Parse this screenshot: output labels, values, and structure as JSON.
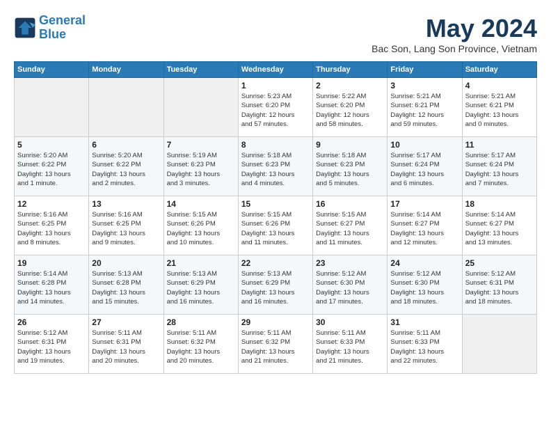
{
  "header": {
    "logo_line1": "General",
    "logo_line2": "Blue",
    "title": "May 2024",
    "subtitle": "Bac Son, Lang Son Province, Vietnam"
  },
  "days_of_week": [
    "Sunday",
    "Monday",
    "Tuesday",
    "Wednesday",
    "Thursday",
    "Friday",
    "Saturday"
  ],
  "weeks": [
    [
      {
        "day": "",
        "info": ""
      },
      {
        "day": "",
        "info": ""
      },
      {
        "day": "",
        "info": ""
      },
      {
        "day": "1",
        "info": "Sunrise: 5:23 AM\nSunset: 6:20 PM\nDaylight: 12 hours\nand 57 minutes."
      },
      {
        "day": "2",
        "info": "Sunrise: 5:22 AM\nSunset: 6:20 PM\nDaylight: 12 hours\nand 58 minutes."
      },
      {
        "day": "3",
        "info": "Sunrise: 5:21 AM\nSunset: 6:21 PM\nDaylight: 12 hours\nand 59 minutes."
      },
      {
        "day": "4",
        "info": "Sunrise: 5:21 AM\nSunset: 6:21 PM\nDaylight: 13 hours\nand 0 minutes."
      }
    ],
    [
      {
        "day": "5",
        "info": "Sunrise: 5:20 AM\nSunset: 6:22 PM\nDaylight: 13 hours\nand 1 minute."
      },
      {
        "day": "6",
        "info": "Sunrise: 5:20 AM\nSunset: 6:22 PM\nDaylight: 13 hours\nand 2 minutes."
      },
      {
        "day": "7",
        "info": "Sunrise: 5:19 AM\nSunset: 6:23 PM\nDaylight: 13 hours\nand 3 minutes."
      },
      {
        "day": "8",
        "info": "Sunrise: 5:18 AM\nSunset: 6:23 PM\nDaylight: 13 hours\nand 4 minutes."
      },
      {
        "day": "9",
        "info": "Sunrise: 5:18 AM\nSunset: 6:23 PM\nDaylight: 13 hours\nand 5 minutes."
      },
      {
        "day": "10",
        "info": "Sunrise: 5:17 AM\nSunset: 6:24 PM\nDaylight: 13 hours\nand 6 minutes."
      },
      {
        "day": "11",
        "info": "Sunrise: 5:17 AM\nSunset: 6:24 PM\nDaylight: 13 hours\nand 7 minutes."
      }
    ],
    [
      {
        "day": "12",
        "info": "Sunrise: 5:16 AM\nSunset: 6:25 PM\nDaylight: 13 hours\nand 8 minutes."
      },
      {
        "day": "13",
        "info": "Sunrise: 5:16 AM\nSunset: 6:25 PM\nDaylight: 13 hours\nand 9 minutes."
      },
      {
        "day": "14",
        "info": "Sunrise: 5:15 AM\nSunset: 6:26 PM\nDaylight: 13 hours\nand 10 minutes."
      },
      {
        "day": "15",
        "info": "Sunrise: 5:15 AM\nSunset: 6:26 PM\nDaylight: 13 hours\nand 11 minutes."
      },
      {
        "day": "16",
        "info": "Sunrise: 5:15 AM\nSunset: 6:27 PM\nDaylight: 13 hours\nand 11 minutes."
      },
      {
        "day": "17",
        "info": "Sunrise: 5:14 AM\nSunset: 6:27 PM\nDaylight: 13 hours\nand 12 minutes."
      },
      {
        "day": "18",
        "info": "Sunrise: 5:14 AM\nSunset: 6:27 PM\nDaylight: 13 hours\nand 13 minutes."
      }
    ],
    [
      {
        "day": "19",
        "info": "Sunrise: 5:14 AM\nSunset: 6:28 PM\nDaylight: 13 hours\nand 14 minutes."
      },
      {
        "day": "20",
        "info": "Sunrise: 5:13 AM\nSunset: 6:28 PM\nDaylight: 13 hours\nand 15 minutes."
      },
      {
        "day": "21",
        "info": "Sunrise: 5:13 AM\nSunset: 6:29 PM\nDaylight: 13 hours\nand 16 minutes."
      },
      {
        "day": "22",
        "info": "Sunrise: 5:13 AM\nSunset: 6:29 PM\nDaylight: 13 hours\nand 16 minutes."
      },
      {
        "day": "23",
        "info": "Sunrise: 5:12 AM\nSunset: 6:30 PM\nDaylight: 13 hours\nand 17 minutes."
      },
      {
        "day": "24",
        "info": "Sunrise: 5:12 AM\nSunset: 6:30 PM\nDaylight: 13 hours\nand 18 minutes."
      },
      {
        "day": "25",
        "info": "Sunrise: 5:12 AM\nSunset: 6:31 PM\nDaylight: 13 hours\nand 18 minutes."
      }
    ],
    [
      {
        "day": "26",
        "info": "Sunrise: 5:12 AM\nSunset: 6:31 PM\nDaylight: 13 hours\nand 19 minutes."
      },
      {
        "day": "27",
        "info": "Sunrise: 5:11 AM\nSunset: 6:31 PM\nDaylight: 13 hours\nand 20 minutes."
      },
      {
        "day": "28",
        "info": "Sunrise: 5:11 AM\nSunset: 6:32 PM\nDaylight: 13 hours\nand 20 minutes."
      },
      {
        "day": "29",
        "info": "Sunrise: 5:11 AM\nSunset: 6:32 PM\nDaylight: 13 hours\nand 21 minutes."
      },
      {
        "day": "30",
        "info": "Sunrise: 5:11 AM\nSunset: 6:33 PM\nDaylight: 13 hours\nand 21 minutes."
      },
      {
        "day": "31",
        "info": "Sunrise: 5:11 AM\nSunset: 6:33 PM\nDaylight: 13 hours\nand 22 minutes."
      },
      {
        "day": "",
        "info": ""
      }
    ]
  ]
}
